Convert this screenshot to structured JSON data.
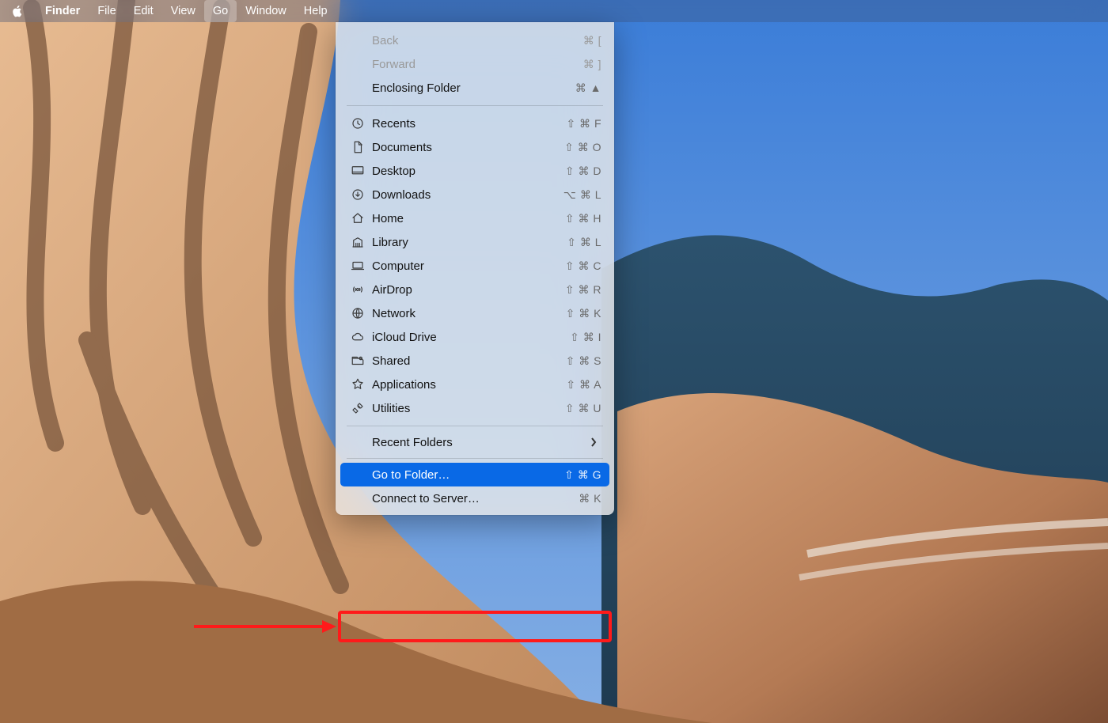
{
  "menubar": {
    "items": [
      {
        "id": "apple",
        "label": "",
        "icon": "apple-logo"
      },
      {
        "id": "finder",
        "label": "Finder",
        "bold": true
      },
      {
        "id": "file",
        "label": "File"
      },
      {
        "id": "edit",
        "label": "Edit"
      },
      {
        "id": "view",
        "label": "View"
      },
      {
        "id": "go",
        "label": "Go",
        "active": true
      },
      {
        "id": "window",
        "label": "Window"
      },
      {
        "id": "help",
        "label": "Help"
      }
    ]
  },
  "go_menu": {
    "nav": {
      "back": {
        "label": "Back",
        "shortcut": "⌘ [",
        "enabled": false
      },
      "forward": {
        "label": "Forward",
        "shortcut": "⌘ ]",
        "enabled": false
      },
      "enclosing": {
        "label": "Enclosing Folder",
        "shortcut": "⌘ ▲",
        "enabled": true
      }
    },
    "locations": [
      {
        "icon": "clock-icon",
        "label": "Recents",
        "shortcut": "⇧ ⌘ F"
      },
      {
        "icon": "document-icon",
        "label": "Documents",
        "shortcut": "⇧ ⌘ O"
      },
      {
        "icon": "desktop-icon",
        "label": "Desktop",
        "shortcut": "⇧ ⌘ D"
      },
      {
        "icon": "download-icon",
        "label": "Downloads",
        "shortcut": "⌥ ⌘ L"
      },
      {
        "icon": "home-icon",
        "label": "Home",
        "shortcut": "⇧ ⌘ H"
      },
      {
        "icon": "library-icon",
        "label": "Library",
        "shortcut": "⇧ ⌘ L"
      },
      {
        "icon": "computer-icon",
        "label": "Computer",
        "shortcut": "⇧ ⌘ C"
      },
      {
        "icon": "airdrop-icon",
        "label": "AirDrop",
        "shortcut": "⇧ ⌘ R"
      },
      {
        "icon": "network-icon",
        "label": "Network",
        "shortcut": "⇧ ⌘ K"
      },
      {
        "icon": "cloud-icon",
        "label": "iCloud Drive",
        "shortcut": "⇧ ⌘ I"
      },
      {
        "icon": "shared-icon",
        "label": "Shared",
        "shortcut": "⇧ ⌘ S"
      },
      {
        "icon": "apps-icon",
        "label": "Applications",
        "shortcut": "⇧ ⌘ A"
      },
      {
        "icon": "utilities-icon",
        "label": "Utilities",
        "shortcut": "⇧ ⌘ U"
      }
    ],
    "recent_folders": {
      "label": "Recent Folders",
      "submenu": true
    },
    "go_to_folder": {
      "label": "Go to Folder…",
      "shortcut": "⇧ ⌘ G",
      "highlighted": true
    },
    "connect_server": {
      "label": "Connect to Server…",
      "shortcut": "⌘ K"
    }
  },
  "annotation": {
    "arrow_color": "#ff1a1a"
  }
}
